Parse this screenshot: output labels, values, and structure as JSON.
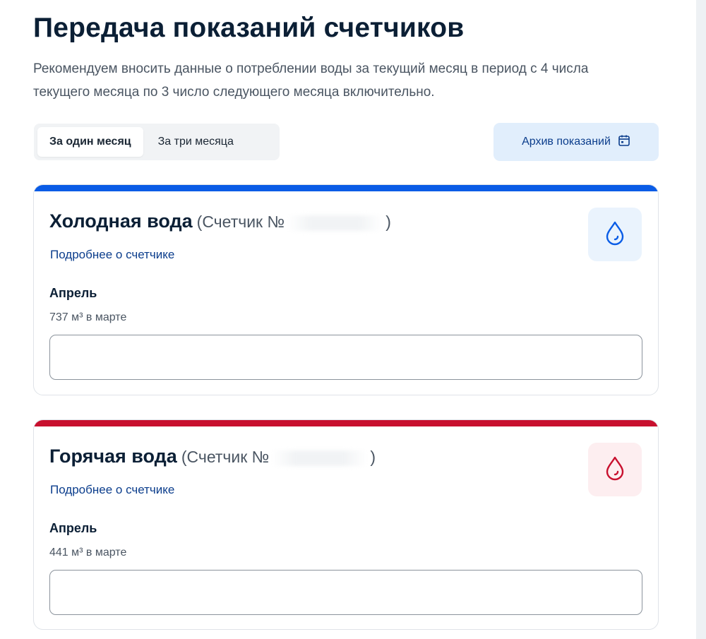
{
  "page": {
    "title": "Передача показаний счетчиков",
    "description": "Рекомендуем вносить данные о потреблении воды за текущий месяц в период с 4 числа текущего месяца по 3 число следующего месяца включительно."
  },
  "tabs": [
    {
      "label": "За один месяц",
      "active": true
    },
    {
      "label": "За три месяца",
      "active": false
    }
  ],
  "archive_button": {
    "label": "Архив показаний",
    "icon": "calendar-icon"
  },
  "meters": [
    {
      "title": "Холодная вода",
      "meter_prefix": "(Счетчик №",
      "meter_suffix": ")",
      "details_link": "Подробнее о счетчике",
      "month": "Апрель",
      "previous_reading": "737 м³ в марте",
      "input_value": "",
      "accent_color": "#0a5ce6",
      "icon": "water-drop-icon",
      "icon_color": "#0a5ce6",
      "icon_bg": "#eaf3fd"
    },
    {
      "title": "Горячая вода",
      "meter_prefix": "(Счетчик №",
      "meter_suffix": ")",
      "details_link": "Подробнее о счетчике",
      "month": "Апрель",
      "previous_reading": "441 м³ в марте",
      "input_value": "",
      "accent_color": "#c8102e",
      "icon": "water-drop-icon",
      "icon_color": "#c8102e",
      "icon_bg": "#fdeef0"
    }
  ]
}
